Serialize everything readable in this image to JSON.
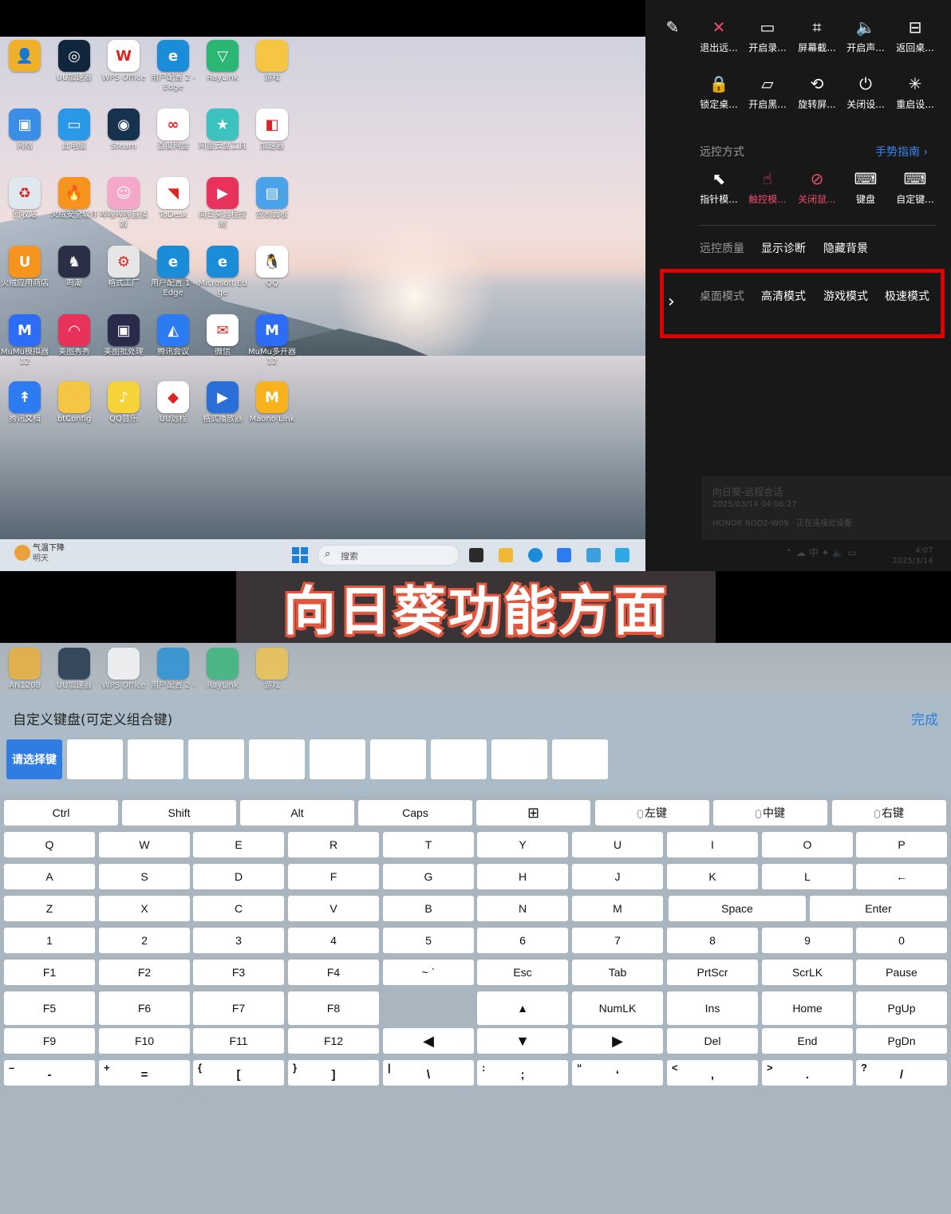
{
  "desktop": {
    "icons": [
      {
        "label": "",
        "color": "#f1b02a",
        "glyph": "👤"
      },
      {
        "label": "UU加速器",
        "color": "#10263d",
        "glyph": "◎"
      },
      {
        "label": "WPS Office",
        "color": "#ffffff",
        "glyph": "W"
      },
      {
        "label": "用户配置 2 - Edge",
        "color": "#1a8cd8",
        "glyph": "e"
      },
      {
        "label": "RayLink",
        "color": "#2bb673",
        "glyph": "▽"
      },
      {
        "label": "游戏",
        "color": "#f6c544",
        "glyph": ""
      },
      {
        "label": "网络",
        "color": "#3a8ee6",
        "glyph": "▣"
      },
      {
        "label": "此电脑",
        "color": "#2a9ae8",
        "glyph": "▭"
      },
      {
        "label": "Steam",
        "color": "#17324e",
        "glyph": "◉"
      },
      {
        "label": "百度网盘",
        "color": "#ffffff",
        "glyph": "∞"
      },
      {
        "label": "阿里云盘工具",
        "color": "#3cc3c0",
        "glyph": "★"
      },
      {
        "label": "加速器",
        "color": "#ffffff",
        "glyph": "◧"
      },
      {
        "label": "回收站",
        "color": "#dfe8ef",
        "glyph": "♻"
      },
      {
        "label": "火绒安全软件",
        "color": "#f7941e",
        "glyph": "🔥"
      },
      {
        "label": "哔哩哔哩直播姬",
        "color": "#f4a7c8",
        "glyph": "☺"
      },
      {
        "label": "ToDesk",
        "color": "#ffffff",
        "glyph": "◥"
      },
      {
        "label": "向日葵远程控制",
        "color": "#e8325c",
        "glyph": "▶"
      },
      {
        "label": "控制面板",
        "color": "#4aa3e8",
        "glyph": "▤"
      },
      {
        "label": "火绒应用商店",
        "color": "#f7941e",
        "glyph": "U"
      },
      {
        "label": "鸣潮",
        "color": "#2a2f45",
        "glyph": "♞"
      },
      {
        "label": "格式工厂",
        "color": "#e6e6e6",
        "glyph": "⚙"
      },
      {
        "label": "用户配置 1 - Edge",
        "color": "#1a8cd8",
        "glyph": "e"
      },
      {
        "label": "Microsoft Edge",
        "color": "#1a8cd8",
        "glyph": "e"
      },
      {
        "label": "QQ",
        "color": "#ffffff",
        "glyph": "🐧"
      },
      {
        "label": "MuMu模拟器12",
        "color": "#2d6cf5",
        "glyph": "M"
      },
      {
        "label": "美图秀秀",
        "color": "#e8325c",
        "glyph": "◠"
      },
      {
        "label": "美图批处理",
        "color": "#2a2a4a",
        "glyph": "▣"
      },
      {
        "label": "腾讯会议",
        "color": "#2d7bf2",
        "glyph": "◭"
      },
      {
        "label": "微信",
        "color": "#ffffff",
        "glyph": "✉"
      },
      {
        "label": "MuMu多开器12",
        "color": "#2d6cf5",
        "glyph": "M"
      },
      {
        "label": "腾讯文档",
        "color": "#2d7bf2",
        "glyph": "↟"
      },
      {
        "label": "btConfig",
        "color": "#f6c544",
        "glyph": ""
      },
      {
        "label": "QQ音乐",
        "color": "#f7d33a",
        "glyph": "♪"
      },
      {
        "label": "UU远程",
        "color": "#ffffff",
        "glyph": "◆"
      },
      {
        "label": "格式播放器",
        "color": "#2a6fd8",
        "glyph": "▶"
      },
      {
        "label": "Maono Link",
        "color": "#f7b21e",
        "glyph": "M"
      }
    ],
    "weather_line1": "气温下降",
    "weather_line2": "明天",
    "search_placeholder": "搜索",
    "clock_time": "4:07",
    "clock_date": "2025/3/14",
    "ime": "中",
    "notification": {
      "title": "向日葵-远程会话",
      "time": "2025/03/14 04:06:27",
      "device": "HONOR ROD2-W09",
      "status": "正在连接此设备"
    }
  },
  "overlay": {
    "row1": [
      {
        "icon": "edit-icon",
        "glyph": "✎",
        "label": ""
      },
      {
        "icon": "close-icon",
        "glyph": "✕",
        "label": "退出远...",
        "accent": true
      },
      {
        "icon": "video-camera-icon",
        "glyph": "▭",
        "label": "开启录..."
      },
      {
        "icon": "crop-icon",
        "glyph": "⌗",
        "label": "屏幕截..."
      },
      {
        "icon": "speaker-icon",
        "glyph": "🔈",
        "label": "开启声..."
      },
      {
        "icon": "desktop-return-icon",
        "glyph": "⊟",
        "label": "返回桌..."
      }
    ],
    "row2": [
      {
        "icon": "lock-icon",
        "glyph": "🔒",
        "label": "锁定桌..."
      },
      {
        "icon": "black-screen-icon",
        "glyph": "▱",
        "label": "开启黑..."
      },
      {
        "icon": "rotate-icon",
        "glyph": "⟲",
        "label": "旋转屏..."
      },
      {
        "icon": "power-icon",
        "glyph": "⏻",
        "label": "关闭设..."
      },
      {
        "icon": "restart-icon",
        "glyph": "✳",
        "label": "重启设..."
      }
    ],
    "control_mode_title": "远控方式",
    "gesture_guide": "手势指南",
    "row3": [
      {
        "icon": "pointer-icon",
        "glyph": "⬉",
        "label": "指针模...",
        "pink": false
      },
      {
        "icon": "touch-icon",
        "glyph": "☝",
        "label": "触控模...",
        "pink": true
      },
      {
        "icon": "mouse-off-icon",
        "glyph": "⊘",
        "label": "关闭鼠...",
        "pink": true
      },
      {
        "icon": "keyboard-icon",
        "glyph": "⌨",
        "label": "键盘",
        "pink": false
      },
      {
        "icon": "custom-keyboard-icon",
        "glyph": "⌨",
        "label": "自定键...",
        "pink": false
      }
    ],
    "quality_title": "远控质量",
    "show_diagnosis": "显示诊断",
    "hide_background": "隐藏背景",
    "mode_title": "桌面模式",
    "modes": [
      "高清模式",
      "游戏模式",
      "极速模式"
    ],
    "active_mode": "游戏模式",
    "colors": {
      "accent": "#f04a6f",
      "link": "#3a86f0",
      "highlight_box": "#e00000"
    }
  },
  "banner": {
    "text": "向日葵功能方面"
  },
  "bottom": {
    "strip_icons": [
      {
        "label": "AN1208",
        "color": "#f1b02a"
      },
      {
        "label": "UU加速器",
        "color": "#10263d"
      },
      {
        "label": "WPS Office",
        "color": "#ffffff"
      },
      {
        "label": "用户配置 2 -",
        "color": "#1a8cd8"
      },
      {
        "label": "RayLink",
        "color": "#2bb673"
      },
      {
        "label": "游戏",
        "color": "#f6c544"
      }
    ],
    "keyboard_title": "自定义键盘(可定义组合键)",
    "done_label": "完成",
    "select_key_label": "请选择键",
    "keys": {
      "row_mod": [
        "Ctrl",
        "Shift",
        "Alt",
        "Caps",
        "",
        "左键",
        "中键",
        "右键"
      ],
      "row_q": [
        "Q",
        "W",
        "E",
        "R",
        "T",
        "Y",
        "U",
        "I",
        "O",
        "P"
      ],
      "row_a": [
        "A",
        "S",
        "D",
        "F",
        "G",
        "H",
        "J",
        "K",
        "L",
        "←"
      ],
      "row_z": [
        "Z",
        "X",
        "C",
        "V",
        "B",
        "N",
        "M",
        "Space",
        "Enter"
      ],
      "row_num": [
        "1",
        "2",
        "3",
        "4",
        "5",
        "6",
        "7",
        "8",
        "9",
        "0"
      ],
      "row_f1": [
        "F1",
        "F2",
        "F3",
        "F4",
        "~ `",
        "Esc",
        "Tab",
        "PrtScr",
        "ScrLK",
        "Pause"
      ],
      "row_f5": [
        "F5",
        "F6",
        "F7",
        "F8",
        "",
        "▲",
        "NumLK",
        "Ins",
        "Home",
        "PgUp"
      ],
      "row_f9": [
        "F9",
        "F10",
        "F11",
        "F12",
        "◀",
        "▼",
        "▶",
        "Del",
        "End",
        "PgDn"
      ],
      "row_sym": [
        [
          "–",
          "-"
        ],
        [
          "+",
          "="
        ],
        [
          "{",
          "["
        ],
        [
          "}",
          "]"
        ],
        [
          "|",
          "\\"
        ],
        [
          ":",
          ";"
        ],
        [
          "“",
          "‘"
        ],
        [
          "<",
          ","
        ],
        [
          ">",
          "."
        ],
        [
          "?",
          "/"
        ]
      ]
    }
  }
}
